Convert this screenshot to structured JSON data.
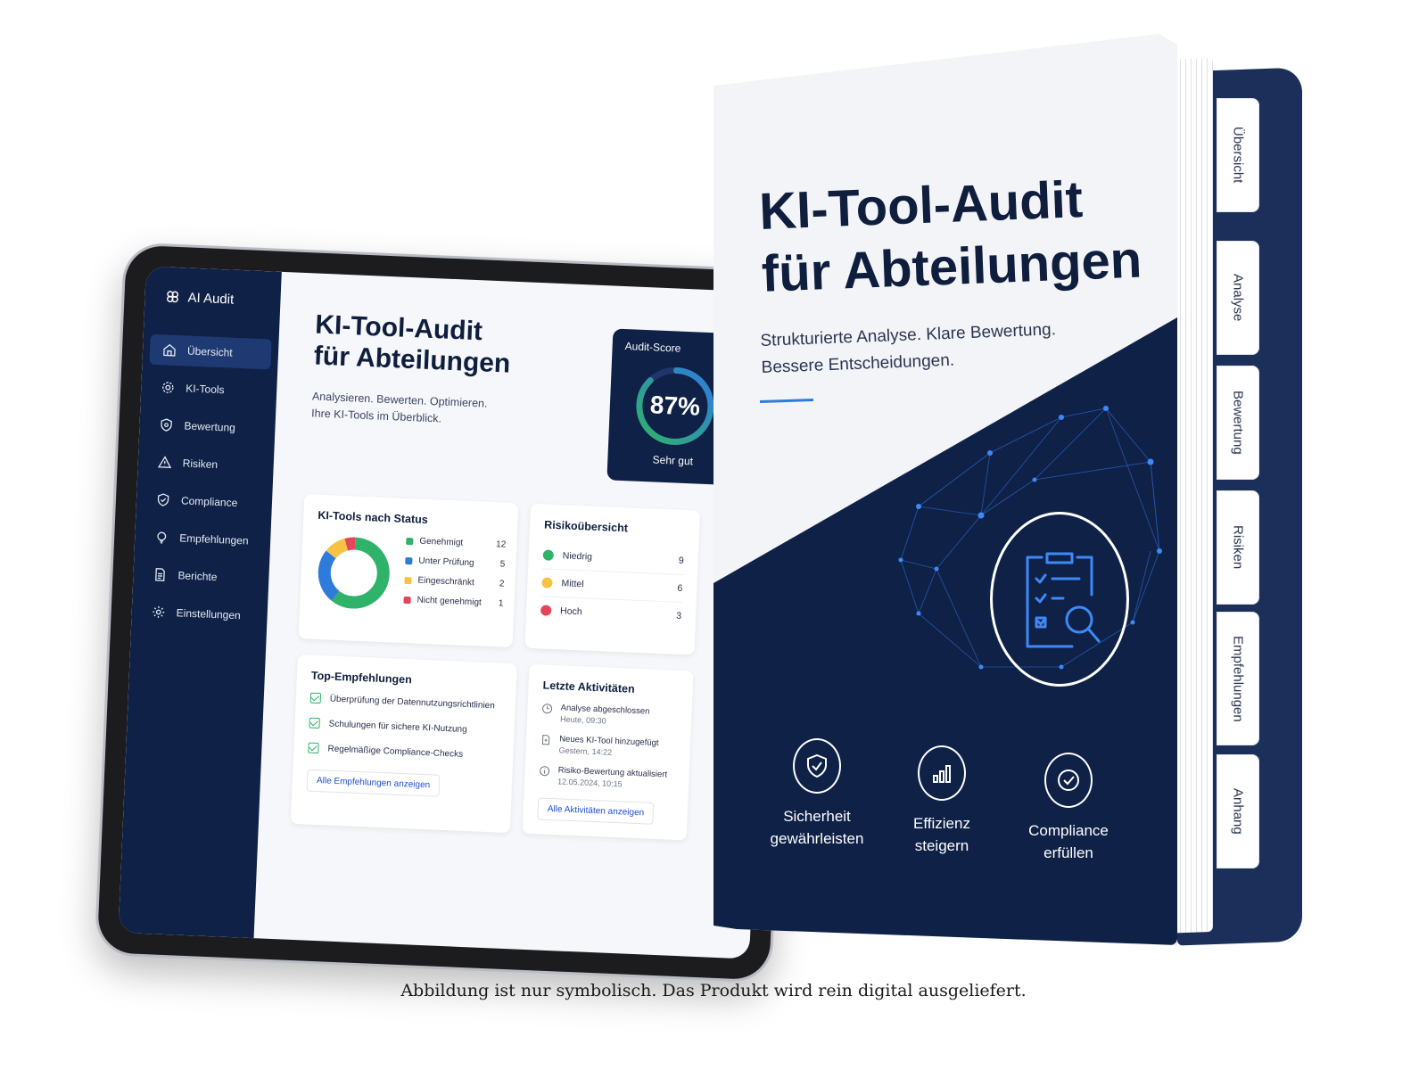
{
  "app": {
    "name": "AI Audit"
  },
  "sidebar": {
    "items": [
      {
        "label": "Übersicht",
        "icon": "home-icon",
        "active": true
      },
      {
        "label": "KI-Tools",
        "icon": "gear-icon"
      },
      {
        "label": "Bewertung",
        "icon": "shield-icon"
      },
      {
        "label": "Risiken",
        "icon": "warning-icon"
      },
      {
        "label": "Compliance",
        "icon": "shield-check-icon"
      },
      {
        "label": "Empfehlungen",
        "icon": "lightbulb-icon"
      },
      {
        "label": "Berichte",
        "icon": "document-icon"
      },
      {
        "label": "Einstellungen",
        "icon": "settings-icon"
      }
    ]
  },
  "dashboard": {
    "title_line1": "KI-Tool-Audit",
    "title_line2": "für Abteilungen",
    "subtitle_line1": "Analysieren. Bewerten. Optimieren.",
    "subtitle_line2": "Ihre KI-Tools im Überblick.",
    "score": {
      "label": "Audit-Score",
      "value": "87%",
      "percent": 87,
      "note": "Sehr gut"
    },
    "status_card": {
      "title": "KI-Tools nach Status",
      "items": [
        {
          "label": "Genehmigt",
          "value": 12,
          "color": "#2fb36a"
        },
        {
          "label": "Unter Prüfung",
          "value": 5,
          "color": "#2f7bdc"
        },
        {
          "label": "Eingeschränkt",
          "value": 2,
          "color": "#f5c242"
        },
        {
          "label": "Nicht genehmigt",
          "value": 1,
          "color": "#e5445a"
        }
      ]
    },
    "risk_card": {
      "title": "Risikoübersicht",
      "items": [
        {
          "label": "Niedrig",
          "value": 9,
          "color": "#2fb36a"
        },
        {
          "label": "Mittel",
          "value": 6,
          "color": "#f5c242"
        },
        {
          "label": "Hoch",
          "value": 3,
          "color": "#e5445a"
        }
      ]
    },
    "reco_card": {
      "title": "Top-Empfehlungen",
      "items": [
        "Überprüfung der Datennutzungsrichtlinien",
        "Schulungen für sichere KI-Nutzung",
        "Regelmäßige Compliance-Checks"
      ],
      "button": "Alle Empfehlungen anzeigen"
    },
    "activity_card": {
      "title": "Letzte Aktivitäten",
      "items": [
        {
          "title": "Analyse abgeschlossen",
          "time": "Heute, 09:30"
        },
        {
          "title": "Neues KI-Tool hinzugefügt",
          "time": "Gestern, 14:22"
        },
        {
          "title": "Risiko-Bewertung aktualisiert",
          "time": "12.05.2024, 10:15"
        }
      ],
      "button": "Alle Aktivitäten anzeigen"
    }
  },
  "binder": {
    "title_line1": "KI-Tool-Audit",
    "title_line2": "für Abteilungen",
    "subtitle_line1": "Strukturierte Analyse. Klare Bewertung.",
    "subtitle_line2": "Bessere Entscheidungen.",
    "tabs": [
      "Übersicht",
      "Analyse",
      "Bewertung",
      "Risiken",
      "Empfehlungen",
      "Anhang"
    ],
    "features": [
      {
        "line1": "Sicherheit",
        "line2": "gewährleisten",
        "icon": "shield-check-icon"
      },
      {
        "line1": "Effizienz",
        "line2": "steigern",
        "icon": "bar-chart-icon"
      },
      {
        "line1": "Compliance",
        "line2": "erfüllen",
        "icon": "check-circle-icon"
      }
    ],
    "emblem_icon": "clipboard-search-icon"
  },
  "disclaimer": "Abbildung ist nur symbolisch. Das Produkt wird rein digital ausgeliefert.",
  "colors": {
    "navy": "#0f2147",
    "accent": "#2f7bdc",
    "success": "#2fb36a",
    "warning": "#f5c242",
    "danger": "#e5445a"
  }
}
